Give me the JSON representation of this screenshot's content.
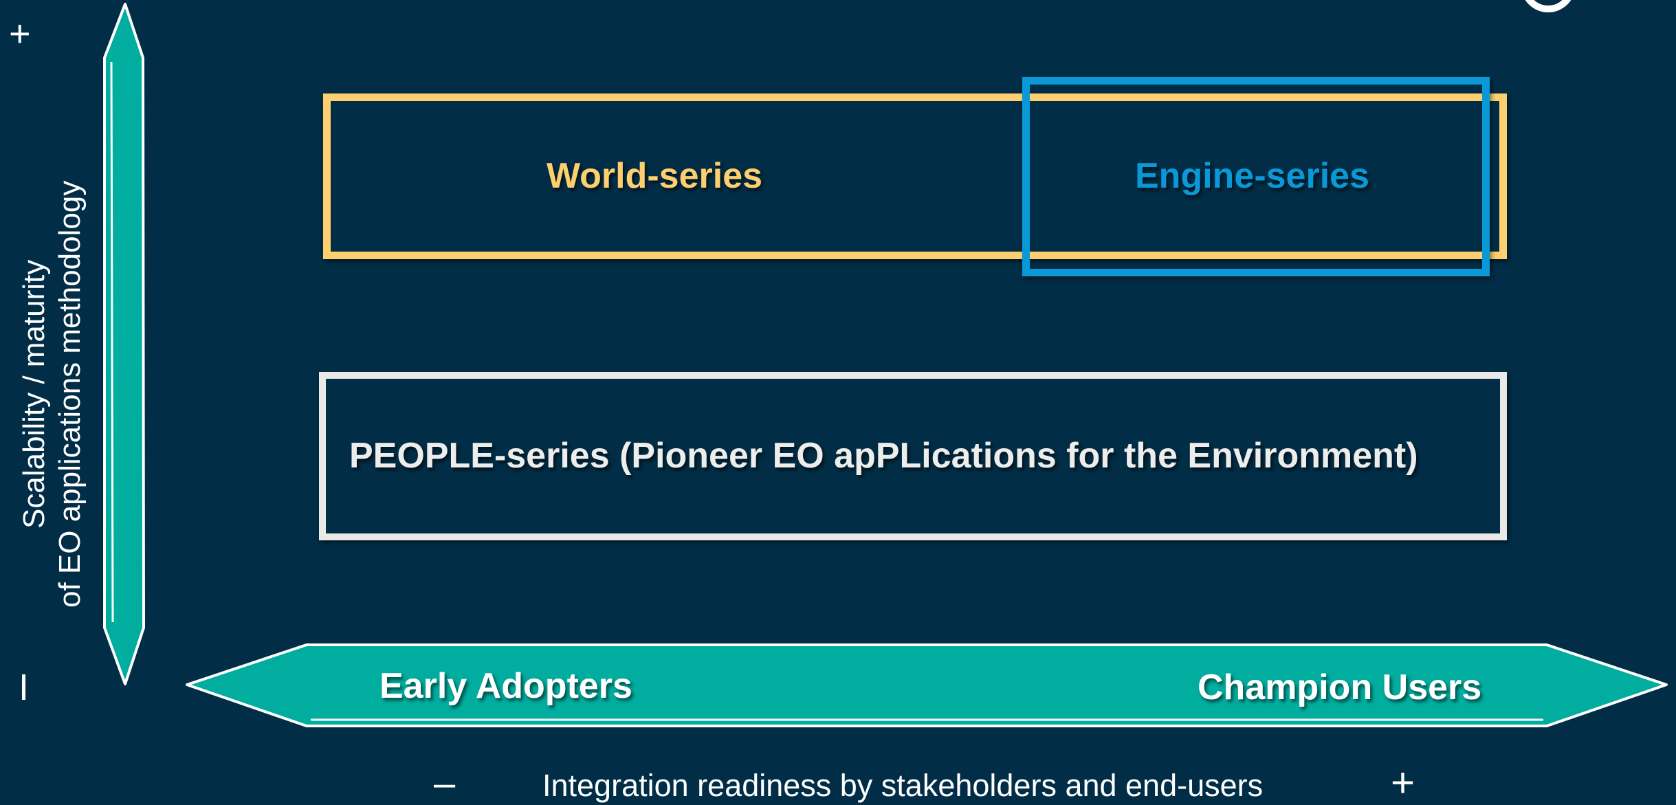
{
  "diagram": {
    "boxes": {
      "world": {
        "label": "World-series",
        "color": "#fecf6e"
      },
      "engine": {
        "label": "Engine-series",
        "color": "#0a98d6"
      },
      "people": {
        "label": "PEOPLE-series (Pioneer EO apPLications for the Environment)",
        "color": "#e9e9e7"
      }
    },
    "x_axis": {
      "label": "Integration readiness by stakeholders and end-users",
      "low_end_label": "Early Adopters",
      "high_end_label": "Champion Users",
      "minus_symbol": "–",
      "plus_symbol": "+",
      "arrow_color": "#00ad9f"
    },
    "y_axis": {
      "label_line1": "Scalability / maturity",
      "label_line2": "of EO applications methodology",
      "minus_symbol": "I",
      "plus_symbol": "+",
      "arrow_color": "#00ad9f"
    },
    "background_color": "#012d46"
  }
}
